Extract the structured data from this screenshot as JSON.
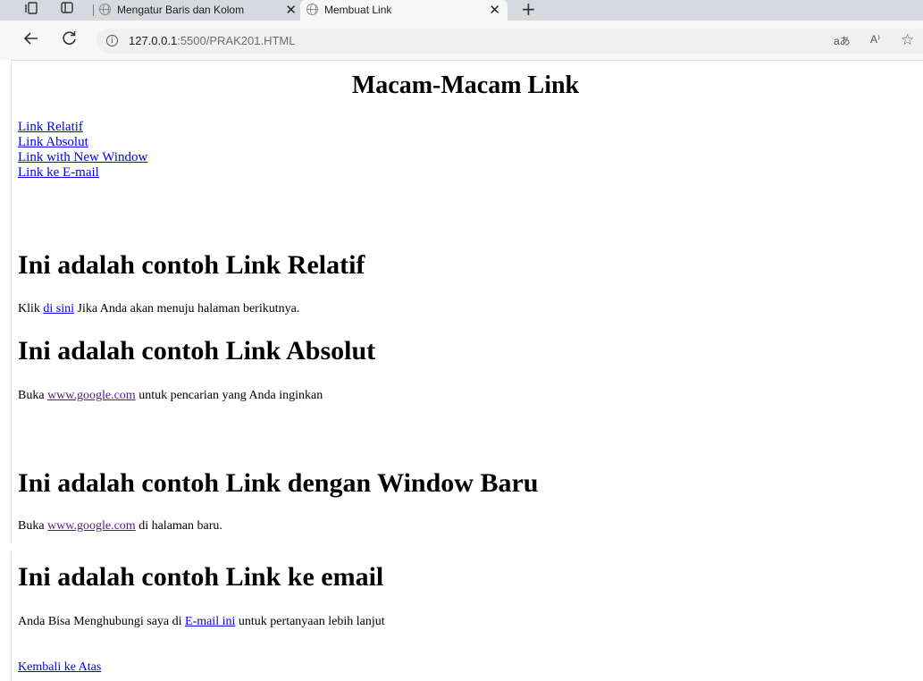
{
  "browser": {
    "tabs": [
      {
        "title": "Mengatur Baris dan Kolom",
        "active": false
      },
      {
        "title": "Membuat Link",
        "active": true
      }
    ],
    "tab_close_glyph": "✕",
    "new_tab_glyph": "+",
    "url_host": "127.0.0.1",
    "url_rest": ":5500/PRAK201.HTML",
    "icons": [
      "workspaces-icon",
      "tab-actions-icon",
      "back-icon",
      "refresh-icon",
      "site-info-icon",
      "translate-icon",
      "read-aloud-icon",
      "favorite-icon"
    ],
    "read_aloud_label": "A⁾",
    "translate_label": "aあ"
  },
  "page": {
    "title": "Macam-Macam Link",
    "nav_links": [
      "Link Relatif",
      "Link Absolut",
      "Link with New Window",
      "Link ke E-mail"
    ],
    "sections": {
      "relatif": {
        "heading": "Ini adalah contoh Link Relatif",
        "before": "Klik ",
        "link": "di sini",
        "after": " Jika Anda akan menuju halaman berikutnya."
      },
      "absolut": {
        "heading": "Ini adalah contoh Link Absolut",
        "before": "Buka ",
        "link": "www.google.com",
        "after": " untuk pencarian yang Anda inginkan"
      },
      "window": {
        "heading": "Ini adalah contoh Link dengan Window Baru",
        "before": "Buka ",
        "link": "www.google.com",
        "after": " di halaman baru."
      },
      "email": {
        "heading": "Ini adalah contoh Link ke email",
        "before": "Anda Bisa Menghubungi saya di ",
        "link": "E-mail ini",
        "after": " untuk pertanyaan lebih lanjut"
      }
    },
    "back_to_top": "Kembali ke Atas"
  },
  "colors": {
    "link": "#0000ee",
    "visited_link": "#551a8b",
    "tab_strip": "#d6d9dd",
    "toolbar": "#f7f7f7"
  }
}
